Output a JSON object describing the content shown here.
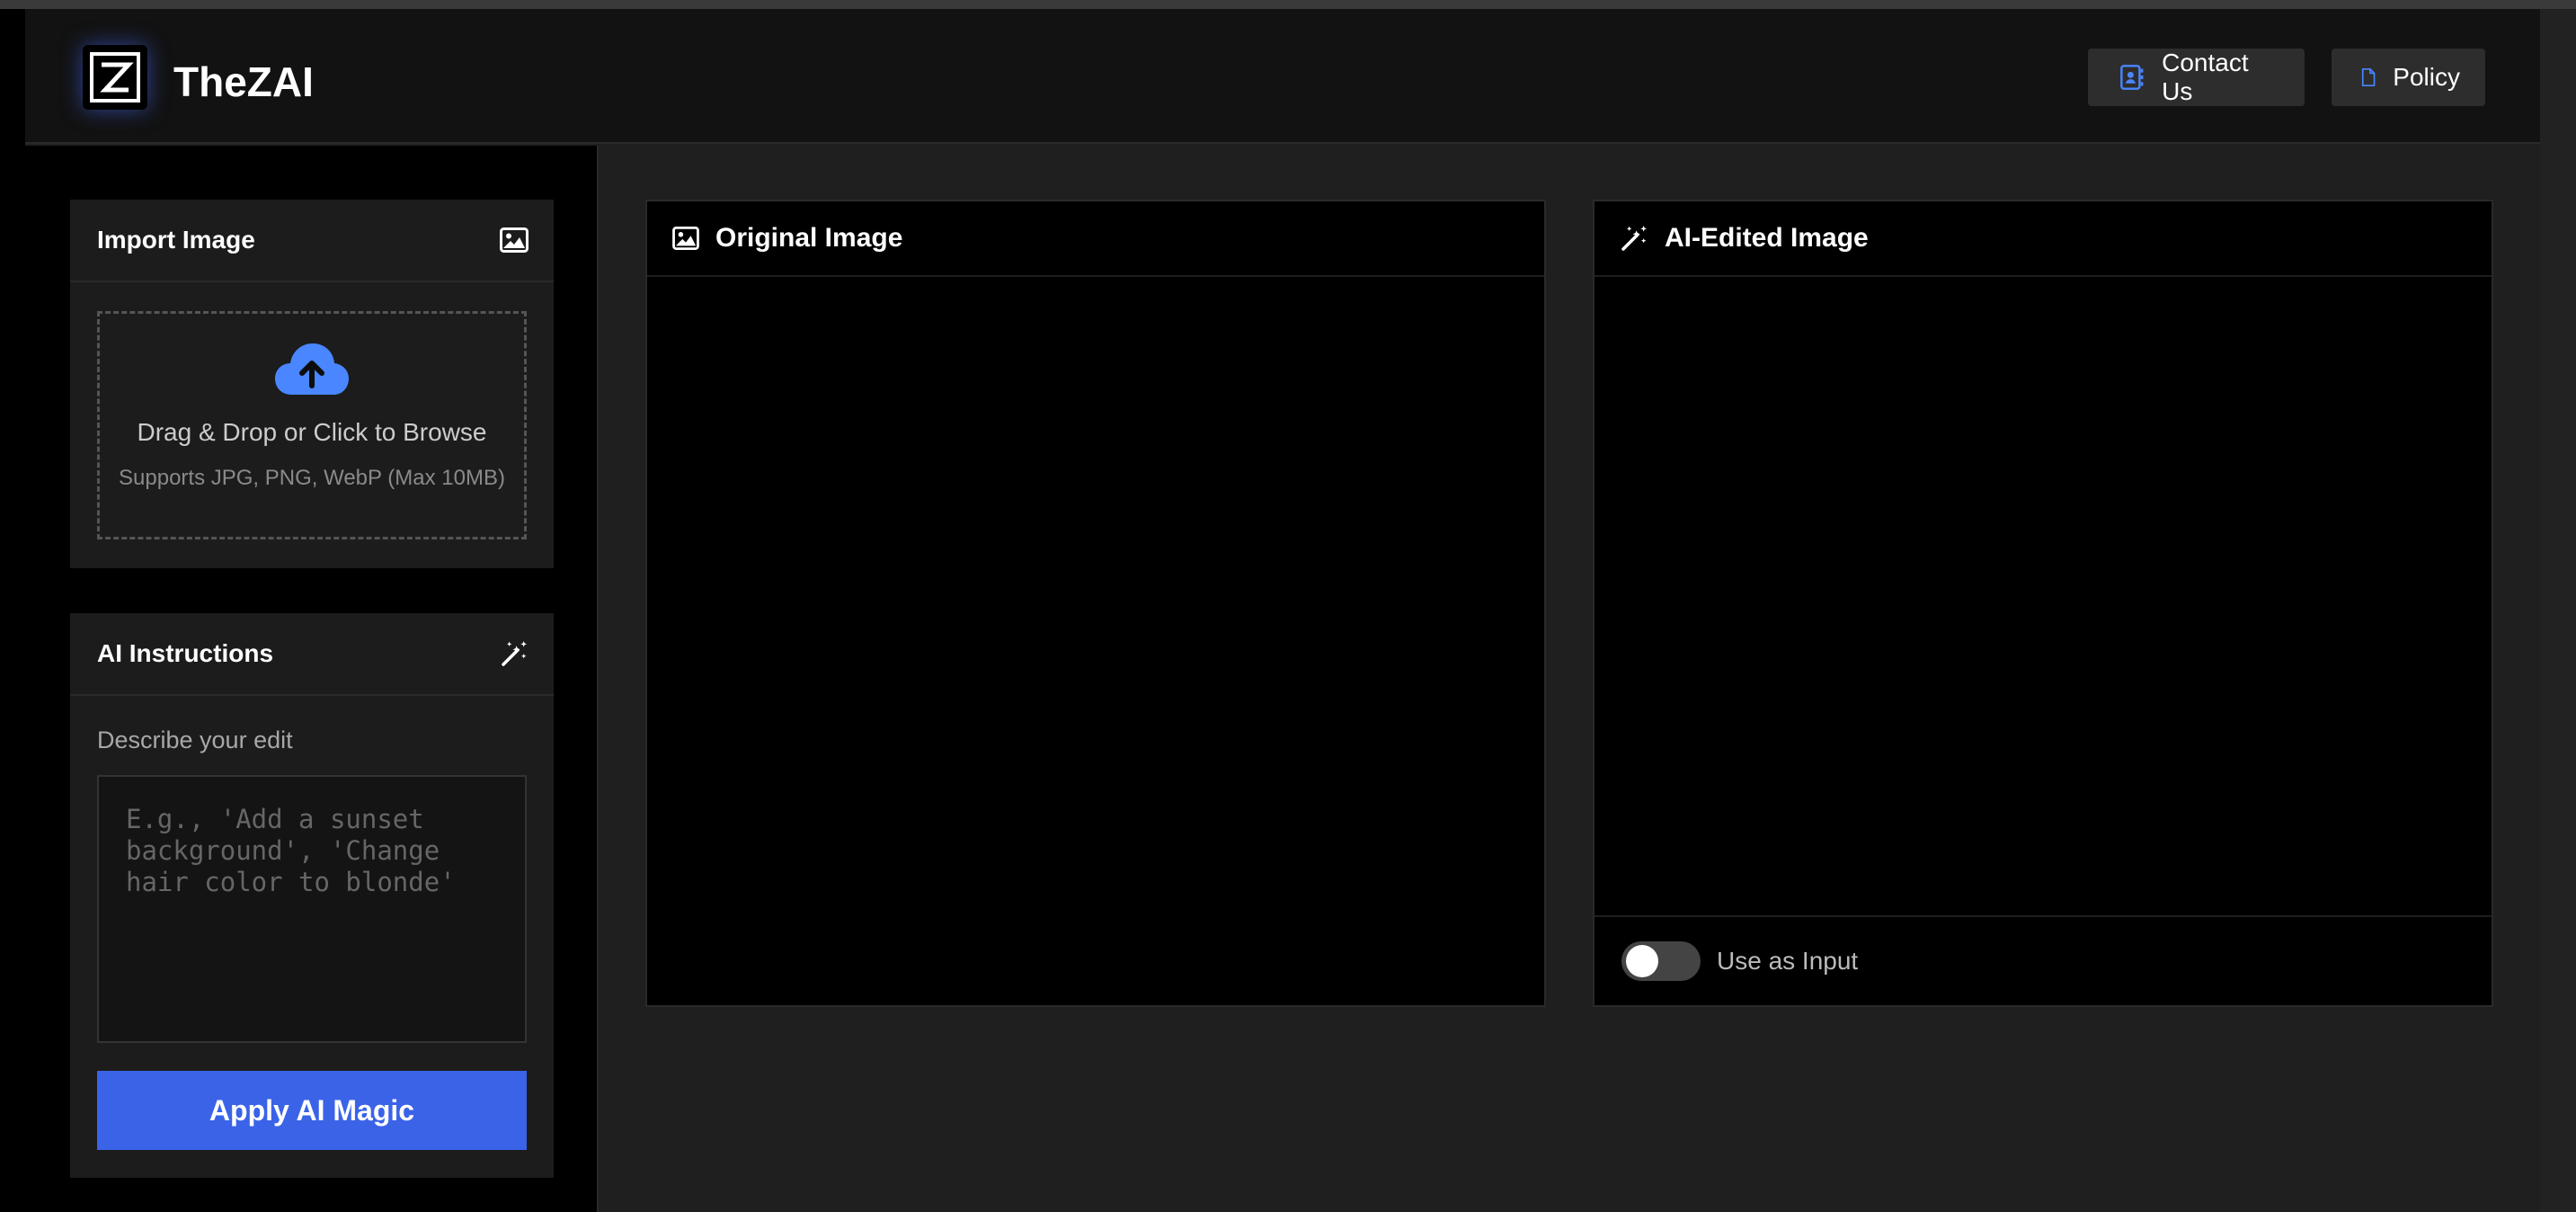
{
  "header": {
    "app_title": "TheZAI",
    "logo_letter": "Z",
    "contact_label": "Contact Us",
    "policy_label": "Policy"
  },
  "import_panel": {
    "title": "Import Image",
    "drop_text": "Drag & Drop or Click to Browse",
    "supports_text": "Supports JPG, PNG, WebP (Max 10MB)"
  },
  "ai_panel": {
    "title": "AI Instructions",
    "field_label": "Describe your edit",
    "prompt_value": "",
    "prompt_placeholder": "E.g., 'Add a sunset background', 'Change hair color to blonde'",
    "apply_label": "Apply AI Magic"
  },
  "original_view": {
    "title": "Original Image"
  },
  "edited_view": {
    "title": "AI-Edited Image",
    "use_as_input_label": "Use as Input",
    "use_as_input_on": false
  },
  "colors": {
    "accent": "#3a63e8",
    "icon_blue": "#4a86ff",
    "background": "#1f1f1f"
  },
  "icons": {
    "contact": "contact-card-icon",
    "policy": "document-icon",
    "import": "image-icon",
    "upload": "cloud-upload-icon",
    "magic": "magic-wand-icon"
  }
}
